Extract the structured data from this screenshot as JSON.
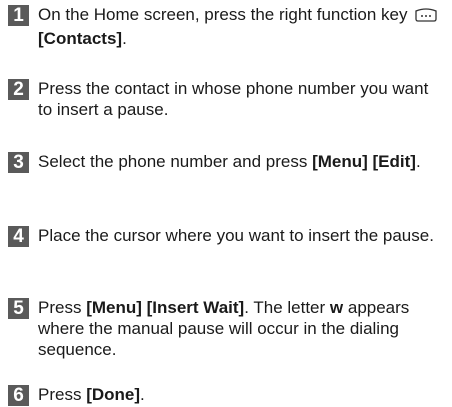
{
  "steps": [
    {
      "number": "1",
      "parts": [
        {
          "t": "On the Home screen, press the right function key "
        },
        {
          "icon": "softkey-icon"
        },
        {
          "t": " "
        },
        {
          "b": "[Contacts]"
        },
        {
          "t": "."
        }
      ]
    },
    {
      "number": "2",
      "parts": [
        {
          "t": "Press the contact in whose phone number you want to insert a pause."
        }
      ]
    },
    {
      "number": "3",
      "parts": [
        {
          "t": "Select the phone number and press "
        },
        {
          "b": "[Menu] [Edit]"
        },
        {
          "t": "."
        }
      ]
    },
    {
      "number": "4",
      "parts": [
        {
          "t": "Place the cursor where you want to insert the pause."
        }
      ]
    },
    {
      "number": "5",
      "parts": [
        {
          "t": "Press "
        },
        {
          "b": "[Menu] [Insert Wait]"
        },
        {
          "t": ". The letter "
        },
        {
          "b": "w"
        },
        {
          "t": " appears where the manual pause will occur in the dialing sequence."
        }
      ]
    },
    {
      "number": "6",
      "parts": [
        {
          "t": "Press "
        },
        {
          "b": "[Done]"
        },
        {
          "t": "."
        }
      ]
    }
  ]
}
